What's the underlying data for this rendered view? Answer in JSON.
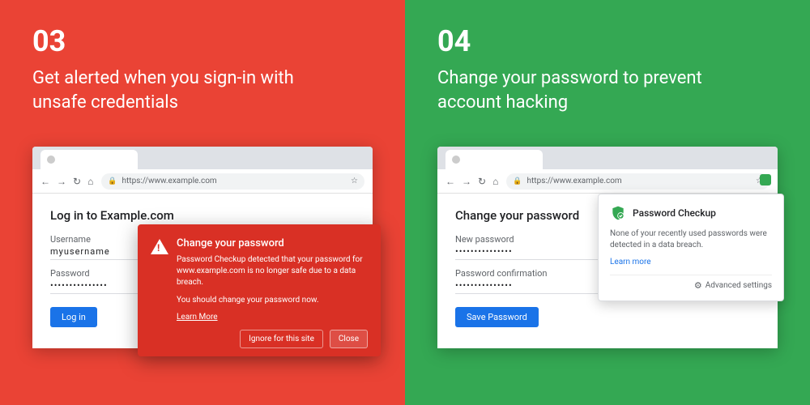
{
  "left": {
    "number": "03",
    "title": "Get alerted when you sign-in with unsafe credentials",
    "url": "https://www.example.com",
    "page_heading": "Log in to Example.com",
    "username_label": "Username",
    "username_value": "myusername",
    "password_label": "Password",
    "password_value": "•••••••••••••••",
    "button": "Log in",
    "alert": {
      "title": "Change your password",
      "body1": "Password Checkup detected that your password for www.example.com is no longer safe due to a data breach.",
      "body2": "You should change your password now.",
      "learn_more": "Learn More",
      "ignore": "Ignore for this site",
      "close": "Close"
    }
  },
  "right": {
    "number": "04",
    "title": "Change your password to prevent account hacking",
    "url": "https://www.example.com",
    "page_heading": "Change your password",
    "newpw_label": "New password",
    "newpw_value": "•••••••••••••••",
    "confirm_label": "Password confirmation",
    "confirm_value": "•••••••••••••••",
    "button": "Save Password",
    "ext": {
      "title": "Password Checkup",
      "body": "None of your recently used passwords were detected in a data breach.",
      "learn_more": "Learn more",
      "advanced": "Advanced settings"
    }
  }
}
